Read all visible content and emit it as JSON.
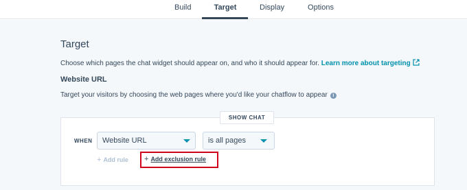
{
  "tabs": [
    {
      "label": "Build"
    },
    {
      "label": "Target"
    },
    {
      "label": "Display"
    },
    {
      "label": "Options"
    }
  ],
  "active_tab": "Target",
  "section": {
    "title": "Target",
    "description": "Choose which pages the chat widget should appear on, and who it should appear for.",
    "learn_more_link": "Learn more about targeting"
  },
  "website_url": {
    "heading": "Website URL",
    "description": "Target your visitors by choosing the web pages where you'd like your chatflow to appear"
  },
  "rule": {
    "show_chat_label": "SHOW CHAT",
    "when_label": "WHEN",
    "field_select_value": "Website URL",
    "condition_select_value": "is all pages",
    "add_rule_label": "Add rule",
    "add_exclusion_rule_label": "Add exclusion rule"
  },
  "icons": {
    "external_link": "external-link-icon",
    "info": "info-icon",
    "caret": "chevron-down-icon",
    "plus": "plus-icon"
  },
  "colors": {
    "link": "#0091ae",
    "text": "#33475b",
    "highlight": "#d0021b",
    "disabled": "#b0c1d4"
  }
}
